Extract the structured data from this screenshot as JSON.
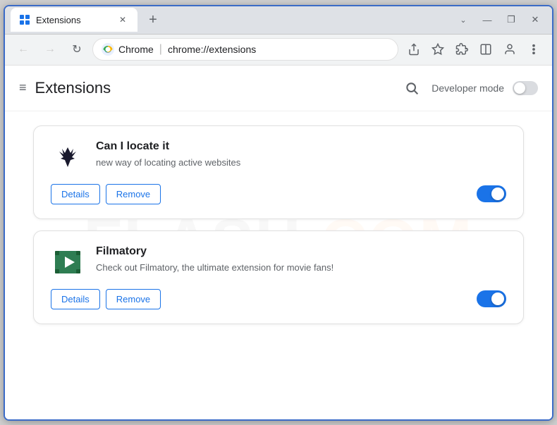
{
  "window": {
    "title": "Extensions",
    "tab_label": "Extensions",
    "close_btn": "✕",
    "new_tab": "+",
    "win_minimize": "—",
    "win_maximize": "❐",
    "win_close": "✕"
  },
  "nav": {
    "back_arrow": "←",
    "forward_arrow": "→",
    "refresh": "↻",
    "browser_name": "Chrome",
    "address": "chrome://extensions",
    "share_icon": "⬆",
    "bookmark_icon": "☆",
    "extensions_icon": "⊞",
    "split_icon": "▭",
    "profile_icon": "⊙",
    "menu_icon": "⋮"
  },
  "page": {
    "menu_icon": "≡",
    "title": "Extensions",
    "search_label": "Search extensions",
    "developer_mode_label": "Developer mode"
  },
  "extensions": [
    {
      "id": "can-locate-it",
      "name": "Can I locate it",
      "description": "new way of locating active websites",
      "details_label": "Details",
      "remove_label": "Remove",
      "enabled": true
    },
    {
      "id": "filmatory",
      "name": "Filmatory",
      "description": "Check out Filmatory, the ultimate extension for movie fans!",
      "details_label": "Details",
      "remove_label": "Remove",
      "enabled": true
    }
  ],
  "watermark": "FLASH.COM"
}
